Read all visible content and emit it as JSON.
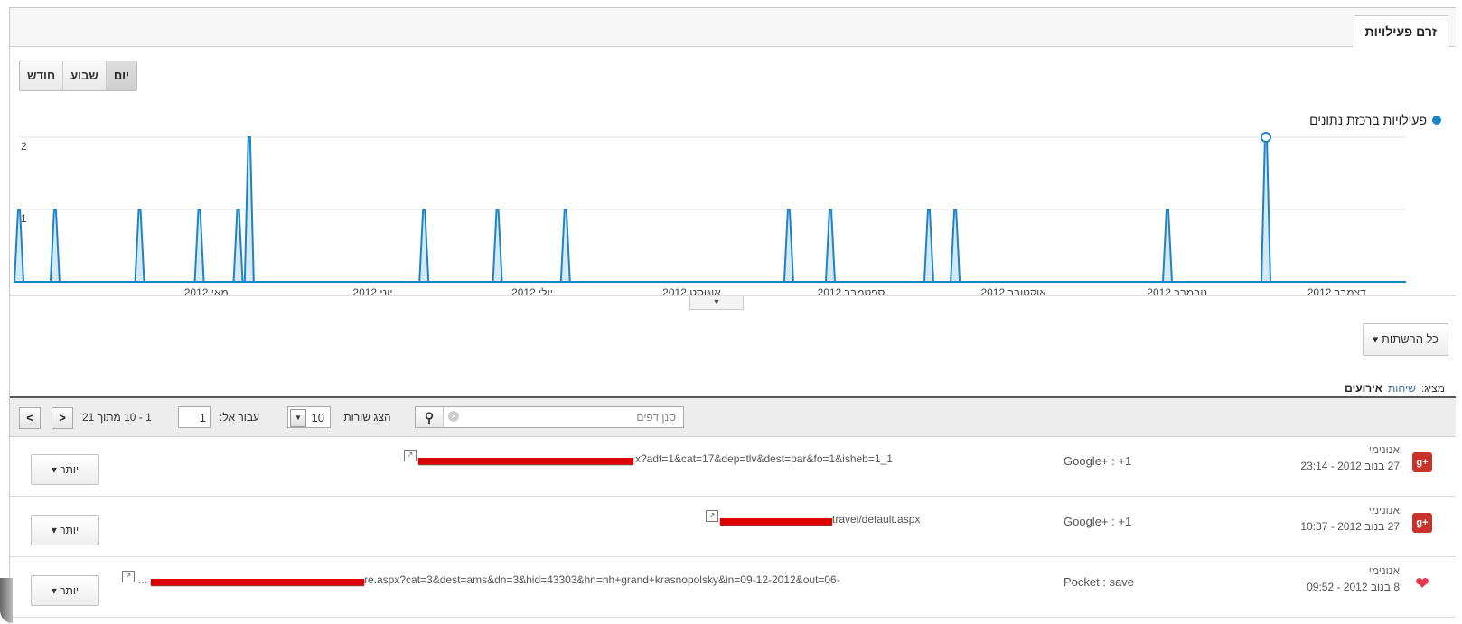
{
  "tab": {
    "active": "זרם פעילויות"
  },
  "period": {
    "day": "יום",
    "week": "שבוע",
    "month": "חודש",
    "selected": "day"
  },
  "legend": {
    "label": "פעילויות ברכזת נתונים",
    "color": "#1c84c6"
  },
  "chart_data": {
    "type": "area",
    "y_ticks": [
      "2",
      "1"
    ],
    "ylim": [
      0,
      2
    ],
    "x_labels": [
      "מאי 2012",
      "יוני 2012",
      "יולי 2012",
      "אוגוסט 2012",
      "ספטמבר 2012",
      "אוקטובר 2012",
      "נובמבר 2012",
      "דצמבר 2012"
    ],
    "series": [
      {
        "values_note": "",
        "peaks": [
          {
            "x": 0.0,
            "y": 1
          },
          {
            "x": 2.6,
            "y": 1
          },
          {
            "x": 8.7,
            "y": 1
          },
          {
            "x": 13.0,
            "y": 1
          },
          {
            "x": 15.8,
            "y": 1
          },
          {
            "x": 16.6,
            "y": 2
          },
          {
            "x": 29.2,
            "y": 1
          },
          {
            "x": 34.5,
            "y": 1
          },
          {
            "x": 39.4,
            "y": 1
          },
          {
            "x": 55.5,
            "y": 1
          },
          {
            "x": 58.5,
            "y": 1
          },
          {
            "x": 65.6,
            "y": 1
          },
          {
            "x": 67.5,
            "y": 1
          },
          {
            "x": 82.8,
            "y": 1
          },
          {
            "x": 89.9,
            "y": 2
          }
        ]
      }
    ],
    "grid": true
  },
  "segments": {
    "label": "כל הרשתות"
  },
  "show": {
    "label": "מציג:",
    "conversations": "שיחות",
    "events": "אירועים"
  },
  "toolbar": {
    "filter_placeholder": "סנן דפים",
    "rows_label": "הצג שורות:",
    "rows_value": "10",
    "goto_label": "עבור אל:",
    "goto_value": "1",
    "range": "1 - 10 מתוך 21",
    "prev": "<",
    "next": ">"
  },
  "rows": [
    {
      "user": "אנונימי",
      "when": "27 בנוב 2012 - 23:14",
      "action": "Google+ : +1",
      "url_tail": "x?adt=1&cat=17&dep=tlv&dest=par&fo=1&isheb=1_1",
      "more": "יותר",
      "service": "gplus",
      "service_label": "g+"
    },
    {
      "user": "אנונימי",
      "when": "27 בנוב 2012 - 10:37",
      "action": "Google+ : +1",
      "url_tail": "travel/default.aspx",
      "more": "יותר",
      "service": "gplus",
      "service_label": "g+"
    },
    {
      "user": "אנונימי",
      "when": "8 בנוב 2012 - 09:52",
      "action": "Pocket : save",
      "url_tail": "re.aspx?cat=3&dest=ams&dn=3&hid=43303&hn=nh+grand+krasnopolsky&in=09-12-2012&out=06-",
      "url_prefix": "...",
      "more": "יותר",
      "service": "pocket",
      "service_label": "❤"
    }
  ]
}
